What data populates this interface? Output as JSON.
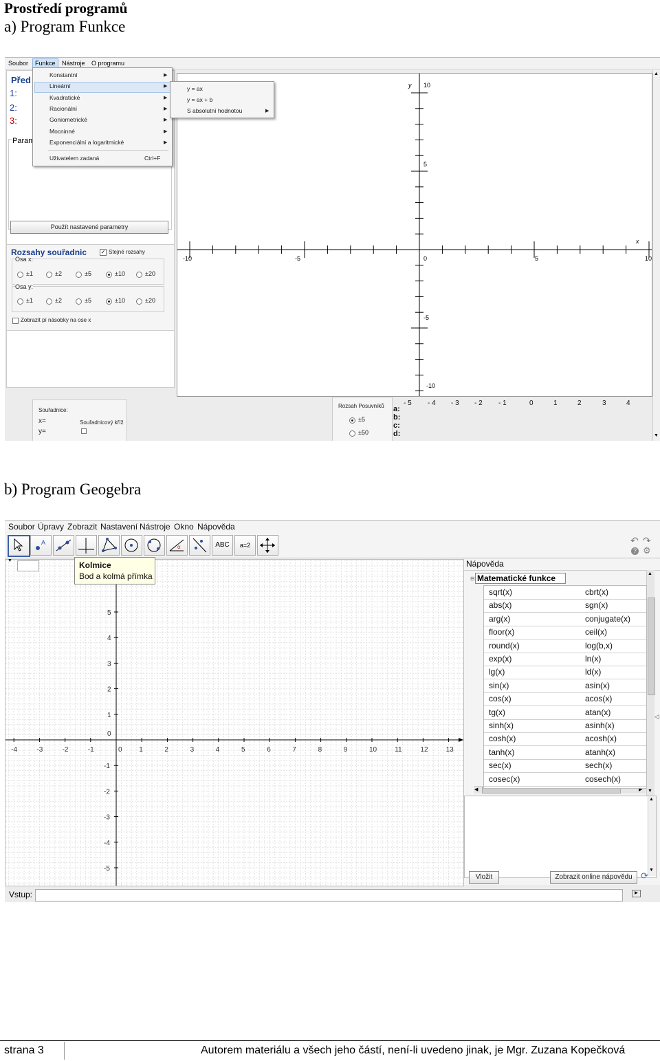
{
  "heading": {
    "title": "Prostředí programů",
    "sub_a": "a) Program Funkce",
    "sub_b": "b) Program Geogebra"
  },
  "funkce": {
    "menu": [
      "Soubor",
      "Funkce",
      "Nástroje",
      "O programu"
    ],
    "func_menu": [
      "Konstantní",
      "Lineární",
      "Kvadratické",
      "Racionální",
      "Goniometrické",
      "Mocninné",
      "Exponenciální a logaritmické",
      "Uživatelem zadaná"
    ],
    "shortcut": "Ctrl+F",
    "sub_menu": [
      "y = ax",
      "y = ax + b",
      "S absolutní hodnotou"
    ],
    "panel_title": "Před",
    "rows": [
      "1:",
      "2:",
      "3:"
    ],
    "param_title": "Param",
    "apply_button": "Použít nastavené parametry",
    "range_title": "Rozsahy souřadnic",
    "same_ranges": "Stejné rozsahy",
    "axis_x": "Osa x:",
    "axis_y": "Osa y:",
    "range_opts": [
      "±1",
      "±2",
      "±5",
      "±10",
      "±20"
    ],
    "pi_multiples": "Zobrazit pí násobky na ose x",
    "axis_label_x": "x",
    "axis_label_y": "y",
    "x_ticks": [
      "-10",
      "-5",
      "0",
      "5",
      "10"
    ],
    "y_ticks": [
      "10",
      "5",
      "-5",
      "-10"
    ],
    "coords_title": "Souřadnice:",
    "coord_x": "x=",
    "coord_y": "y=",
    "cross": "Souřadnicový kříž",
    "slider_title": "Rozsah Posuvníků",
    "slider_opts": [
      "±5",
      "±50"
    ],
    "coef_labels": [
      "a:",
      "b:",
      "c:",
      "d:"
    ],
    "slider_ticks": [
      "- 5",
      "- 4",
      "- 3",
      "- 2",
      "- 1",
      "0",
      "1",
      "2",
      "3",
      "4"
    ]
  },
  "geogebra": {
    "menu": [
      "Soubor",
      "Úpravy",
      "Zobrazit",
      "Nastavení",
      "Nástroje",
      "Okno",
      "Nápověda"
    ],
    "tools": [
      "move-tool",
      "point-tool",
      "line-tool",
      "perpendicular-tool",
      "polygon-tool",
      "circle-tool",
      "conic-tool",
      "angle-tool",
      "reflect-tool",
      "text-tool",
      "slider-tool",
      "move-view-tool"
    ],
    "text_tool_label": "ABC",
    "slider_tool_label": "a=2",
    "tooltip_title": "Kolmice",
    "tooltip_text": "Bod a kolmá přímka",
    "x_ticks": [
      "-4",
      "-3",
      "-2",
      "-1",
      "0",
      "1",
      "2",
      "3",
      "4",
      "5",
      "6",
      "7",
      "8",
      "9",
      "10",
      "11",
      "12",
      "13"
    ],
    "y_ticks": [
      "5",
      "4",
      "3",
      "2",
      "1",
      "0",
      "-1",
      "-2",
      "-3",
      "-4",
      "-5"
    ],
    "help_title": "Nápověda",
    "help_section": "Matematické funkce",
    "functions_left": [
      "sqrt(x)",
      "abs(x)",
      "arg(x)",
      "floor(x)",
      "round(x)",
      "exp(x)",
      "lg(x)",
      "sin(x)",
      "cos(x)",
      "tg(x)",
      "sinh(x)",
      "cosh(x)",
      "tanh(x)",
      "sec(x)",
      "cosec(x)"
    ],
    "functions_right": [
      "cbrt(x)",
      "sgn(x)",
      "conjugate(x)",
      "ceil(x)",
      "log(b,x)",
      "ln(x)",
      "ld(x)",
      "asin(x)",
      "acos(x)",
      "atan(x)",
      "asinh(x)",
      "acosh(x)",
      "atanh(x)",
      "sech(x)",
      "cosech(x)"
    ],
    "insert_button": "Vložit",
    "online_help_button": "Zobrazit online nápovědu",
    "input_label": "Vstup:"
  },
  "footer": {
    "page": "strana 3",
    "author": "Autorem materiálu a všech jeho částí, není-li uvedeno jinak, je Mgr. Zuzana Kopečková"
  }
}
